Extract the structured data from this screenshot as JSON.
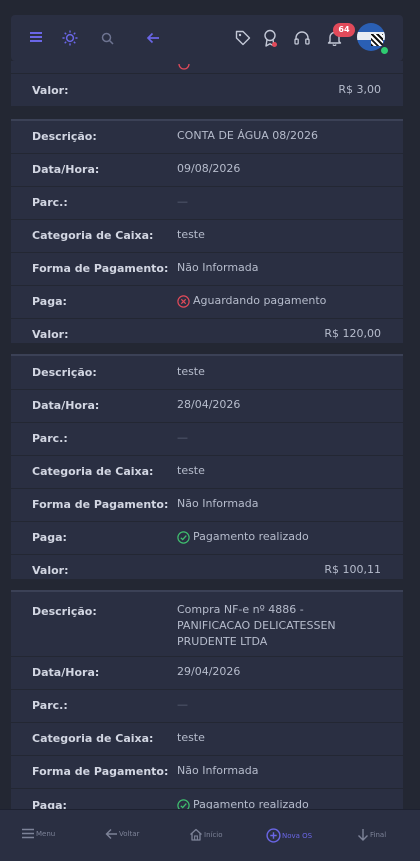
{
  "header": {
    "icons": [
      "menu-icon",
      "sun-icon",
      "search-icon",
      "back-arrow-icon",
      "tag-icon",
      "award-icon",
      "headset-icon",
      "bell-icon"
    ],
    "notification_count": "64"
  },
  "partial_card": {
    "value_label": "Valor:",
    "value": "R$ 3,00"
  },
  "cards": [
    {
      "descricao_label": "Descrição:",
      "descricao": "CONTA DE ÁGUA 08/2026",
      "data_label": "Data/Hora:",
      "data": "09/08/2026",
      "parc_label": "Parc.:",
      "parc": "—",
      "categoria_label": "Categoria de Caixa:",
      "categoria": "teste",
      "forma_label": "Forma de Pagamento:",
      "forma": "Não Informada",
      "paga_label": "Paga:",
      "paga": "Aguardando pagamento",
      "paga_status": "pending",
      "valor_label": "Valor:",
      "valor": "R$ 120,00"
    },
    {
      "descricao_label": "Descrição:",
      "descricao": "teste",
      "data_label": "Data/Hora:",
      "data": "28/04/2026",
      "parc_label": "Parc.:",
      "parc": "—",
      "categoria_label": "Categoria de Caixa:",
      "categoria": "teste",
      "forma_label": "Forma de Pagamento:",
      "forma": "Não Informada",
      "paga_label": "Paga:",
      "paga": "Pagamento realizado",
      "paga_status": "paid",
      "valor_label": "Valor:",
      "valor": "R$ 100,11"
    },
    {
      "descricao_label": "Descrição:",
      "descricao": "Compra NF-e nº 4886 - PANIFICACAO DELICATESSEN PRUDENTE LTDA",
      "data_label": "Data/Hora:",
      "data": "29/04/2026",
      "parc_label": "Parc.:",
      "parc": "—",
      "categoria_label": "Categoria de Caixa:",
      "categoria": "teste",
      "forma_label": "Forma de Pagamento:",
      "forma": "Não Informada",
      "paga_label": "Paga:",
      "paga": "Pagamento realizado",
      "paga_status": "paid"
    }
  ],
  "bottom_nav": {
    "menu": "Menu",
    "voltar": "Voltar",
    "inicio": "Início",
    "nova_os": "Nova OS",
    "final": "Final"
  },
  "colors": {
    "background": "#232733",
    "card": "#2a2f42",
    "accent": "#6a66e6",
    "success": "#3fbf6f",
    "danger": "#e14a5a"
  }
}
